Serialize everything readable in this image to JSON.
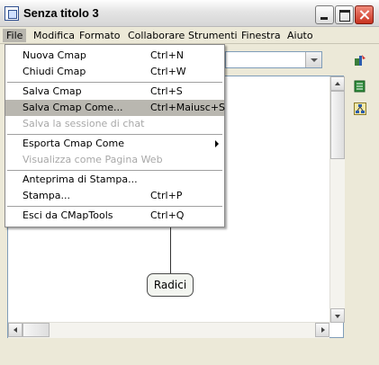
{
  "window": {
    "title": "Senza titolo 3"
  },
  "menubar": {
    "items": [
      {
        "label": "File"
      },
      {
        "label": "Modifica"
      },
      {
        "label": "Formato"
      },
      {
        "label": "Collaborare"
      },
      {
        "label": "Strumenti"
      },
      {
        "label": "Finestra"
      },
      {
        "label": "Aiuto"
      }
    ],
    "active": "File"
  },
  "file_menu": {
    "items": [
      {
        "label": "Nuova Cmap",
        "shortcut": "Ctrl+N",
        "enabled": true
      },
      {
        "label": "Chiudi Cmap",
        "shortcut": "Ctrl+W",
        "enabled": true
      },
      {
        "label": "Salva Cmap",
        "shortcut": "Ctrl+S",
        "enabled": true
      },
      {
        "label": "Salva Cmap Come...",
        "shortcut": "Ctrl+Maiusc+S",
        "enabled": true,
        "highlighted": true
      },
      {
        "label": "Salva la sessione di  chat",
        "shortcut": "",
        "enabled": false
      },
      {
        "label": "Esporta Cmap Come",
        "shortcut": "",
        "enabled": true,
        "submenu": true
      },
      {
        "label": "Visualizza come Pagina Web",
        "shortcut": "",
        "enabled": false
      },
      {
        "label": "Anteprima di Stampa...",
        "shortcut": "",
        "enabled": true
      },
      {
        "label": "Stampa...",
        "shortcut": "Ctrl+P",
        "enabled": true
      },
      {
        "label": "Esci da CMapTools",
        "shortcut": "Ctrl+Q",
        "enabled": true
      }
    ]
  },
  "canvas": {
    "node_label": "Radici"
  },
  "icons": [
    "app-icon",
    "minimize-icon",
    "maximize-icon",
    "close-icon",
    "styles-icon",
    "book-icon",
    "structure-icon"
  ]
}
